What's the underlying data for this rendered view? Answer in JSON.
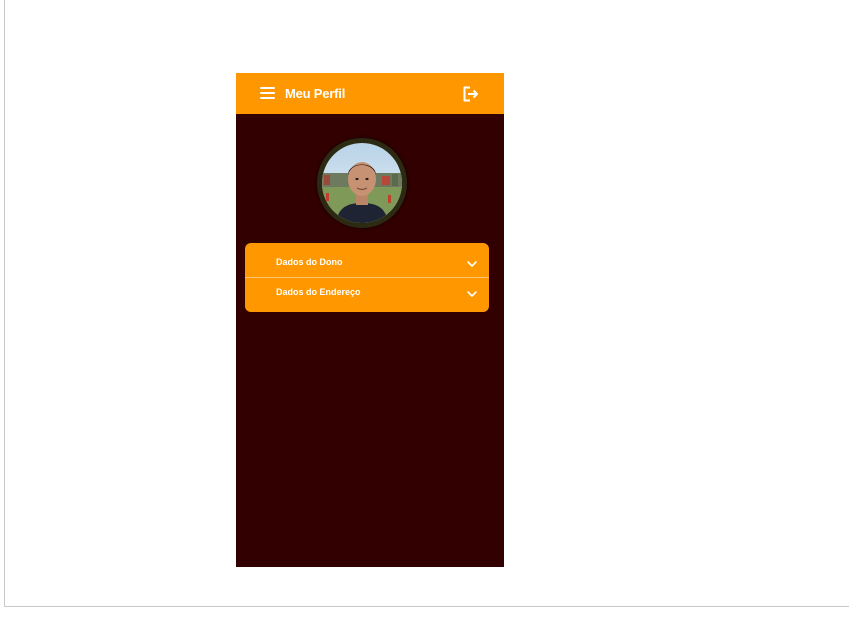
{
  "colors": {
    "appbar": "#ff9800",
    "background": "#320000",
    "text": "#ffffff"
  },
  "appbar": {
    "title": "Meu Perfil",
    "menu_icon": "hamburger-menu-icon",
    "logout_icon": "logout-icon"
  },
  "profile": {
    "avatar_icon": "profile-photo"
  },
  "accordion": {
    "items": [
      {
        "label": "Dados do Dono",
        "icon": "chevron-down-icon"
      },
      {
        "label": "Dados do Endereço",
        "icon": "chevron-down-icon"
      }
    ]
  }
}
